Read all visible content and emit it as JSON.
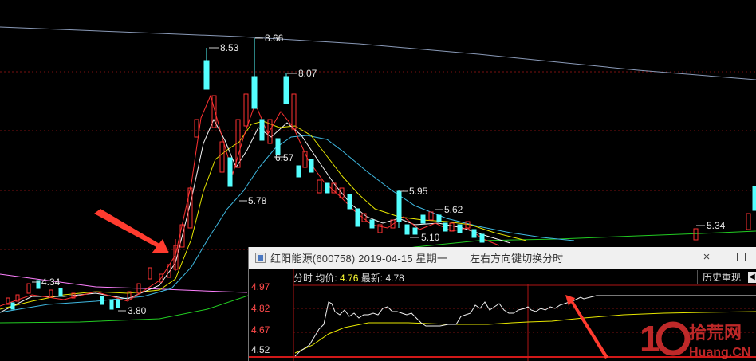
{
  "kline_chart": {
    "price_labels": {
      "high_1": "8.53",
      "high_2": "8.66",
      "high_3": "8.07",
      "low_1": "5.78",
      "low_2": "6.57",
      "high_4": "5.95",
      "high_5": "5.62",
      "low_3": "5.10",
      "high_6": "5.34",
      "left_high": "4.34",
      "left_low": "3.80"
    },
    "colors": {
      "up_candle": "#ff3232",
      "down_candle": "#54ffff",
      "ma_white": "#ffffff",
      "ma_yellow": "#ffff00",
      "ma_magenta": "#ff80ff",
      "ma_green": "#00cc00",
      "ma_cyan": "#3fb8e0",
      "ma_slate": "#8a9ab8",
      "annotation_arrow": "#ff3b2f"
    }
  },
  "popup": {
    "title": "红阳能源(600758) 2019-04-15 星期一",
    "hint": "左右方向键切换分时",
    "close_icon": "×",
    "info": {
      "label_time": "分时",
      "label_avg": "均价:",
      "avg_value": "4.76",
      "label_latest": "最新:",
      "latest_value": "4.78"
    },
    "history_button": "历史重现",
    "collapse_icon": "◀",
    "y_axis": [
      "4.97",
      "4.82",
      "4.67",
      "4.52"
    ]
  },
  "watermark": {
    "text": "10拾荒网",
    "sub": "Huang.CN"
  }
}
